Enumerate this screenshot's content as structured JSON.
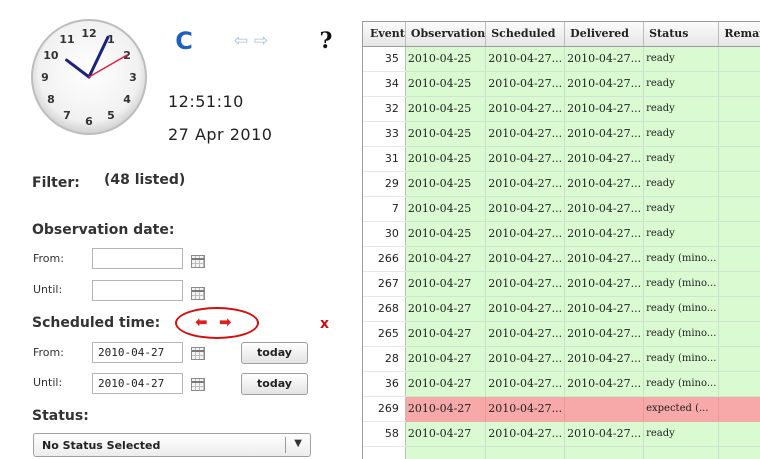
{
  "clock": {
    "numerals": [
      "12",
      "1",
      "2",
      "3",
      "4",
      "5",
      "6",
      "7",
      "8",
      "9",
      "10",
      "11"
    ],
    "time": "12:51:10",
    "date": "27 Apr 2010",
    "hour_hand_color": "#1a237e",
    "minute_hand_color": "#1a237e",
    "second_hand_color": "#e02040"
  },
  "toolbar": {
    "refresh_glyph": "C",
    "back_glyph": "⇦",
    "forward_glyph": "⇨",
    "help_glyph": "?"
  },
  "filter": {
    "label": "Filter:",
    "listed": "(48 listed)",
    "observation_date": {
      "title": "Observation date:",
      "from_label": "From:",
      "from_value": "",
      "until_label": "Until:",
      "until_value": ""
    },
    "scheduled_time": {
      "title": "Scheduled time:",
      "back_glyph": "⬅",
      "forward_glyph": "➡",
      "clear_glyph": "x",
      "from_label": "From:",
      "from_value": "2010-04-27",
      "until_label": "Until:",
      "until_value": "2010-04-27",
      "today_label": "today"
    },
    "status": {
      "title": "Status:",
      "selected": "No Status Selected",
      "chevron": "▼"
    }
  },
  "table": {
    "columns": [
      "Event",
      "Observation",
      "Scheduled",
      "Delivered",
      "Status",
      "Remarks"
    ],
    "rows": [
      {
        "event": "35",
        "observation": "2010-04-25",
        "scheduled": "2010-04-27...",
        "delivered": "2010-04-27...",
        "status": "ready",
        "state": "ready"
      },
      {
        "event": "34",
        "observation": "2010-04-25",
        "scheduled": "2010-04-27...",
        "delivered": "2010-04-27...",
        "status": "ready",
        "state": "ready"
      },
      {
        "event": "32",
        "observation": "2010-04-25",
        "scheduled": "2010-04-27...",
        "delivered": "2010-04-27...",
        "status": "ready",
        "state": "ready"
      },
      {
        "event": "33",
        "observation": "2010-04-25",
        "scheduled": "2010-04-27...",
        "delivered": "2010-04-27...",
        "status": "ready",
        "state": "ready"
      },
      {
        "event": "31",
        "observation": "2010-04-25",
        "scheduled": "2010-04-27...",
        "delivered": "2010-04-27...",
        "status": "ready",
        "state": "ready"
      },
      {
        "event": "29",
        "observation": "2010-04-25",
        "scheduled": "2010-04-27...",
        "delivered": "2010-04-27...",
        "status": "ready",
        "state": "ready"
      },
      {
        "event": "7",
        "observation": "2010-04-25",
        "scheduled": "2010-04-27...",
        "delivered": "2010-04-27...",
        "status": "ready",
        "state": "ready"
      },
      {
        "event": "30",
        "observation": "2010-04-25",
        "scheduled": "2010-04-27...",
        "delivered": "2010-04-27...",
        "status": "ready",
        "state": "ready"
      },
      {
        "event": "266",
        "observation": "2010-04-27",
        "scheduled": "2010-04-27...",
        "delivered": "2010-04-27...",
        "status": "ready (mino...",
        "state": "ready"
      },
      {
        "event": "267",
        "observation": "2010-04-27",
        "scheduled": "2010-04-27...",
        "delivered": "2010-04-27...",
        "status": "ready (mino...",
        "state": "ready"
      },
      {
        "event": "268",
        "observation": "2010-04-27",
        "scheduled": "2010-04-27...",
        "delivered": "2010-04-27...",
        "status": "ready (mino...",
        "state": "ready"
      },
      {
        "event": "265",
        "observation": "2010-04-27",
        "scheduled": "2010-04-27...",
        "delivered": "2010-04-27...",
        "status": "ready (mino...",
        "state": "ready"
      },
      {
        "event": "28",
        "observation": "2010-04-27",
        "scheduled": "2010-04-27...",
        "delivered": "2010-04-27...",
        "status": "ready (mino...",
        "state": "ready"
      },
      {
        "event": "36",
        "observation": "2010-04-27",
        "scheduled": "2010-04-27...",
        "delivered": "2010-04-27...",
        "status": "ready (mino...",
        "state": "ready"
      },
      {
        "event": "269",
        "observation": "2010-04-27",
        "scheduled": "2010-04-27...",
        "delivered": "",
        "status": "expected (...",
        "state": "expected"
      },
      {
        "event": "58",
        "observation": "2010-04-27",
        "scheduled": "2010-04-27...",
        "delivered": "2010-04-27...",
        "status": "ready",
        "state": "ready"
      },
      {
        "event": "",
        "observation": "",
        "scheduled": "",
        "delivered": "",
        "status": "",
        "state": "ready"
      }
    ]
  },
  "colors": {
    "ready_row": "#dafbd2",
    "expected_row": "#f7a8a8",
    "accent_red": "#e02020",
    "refresh_blue": "#1f5fbf"
  }
}
